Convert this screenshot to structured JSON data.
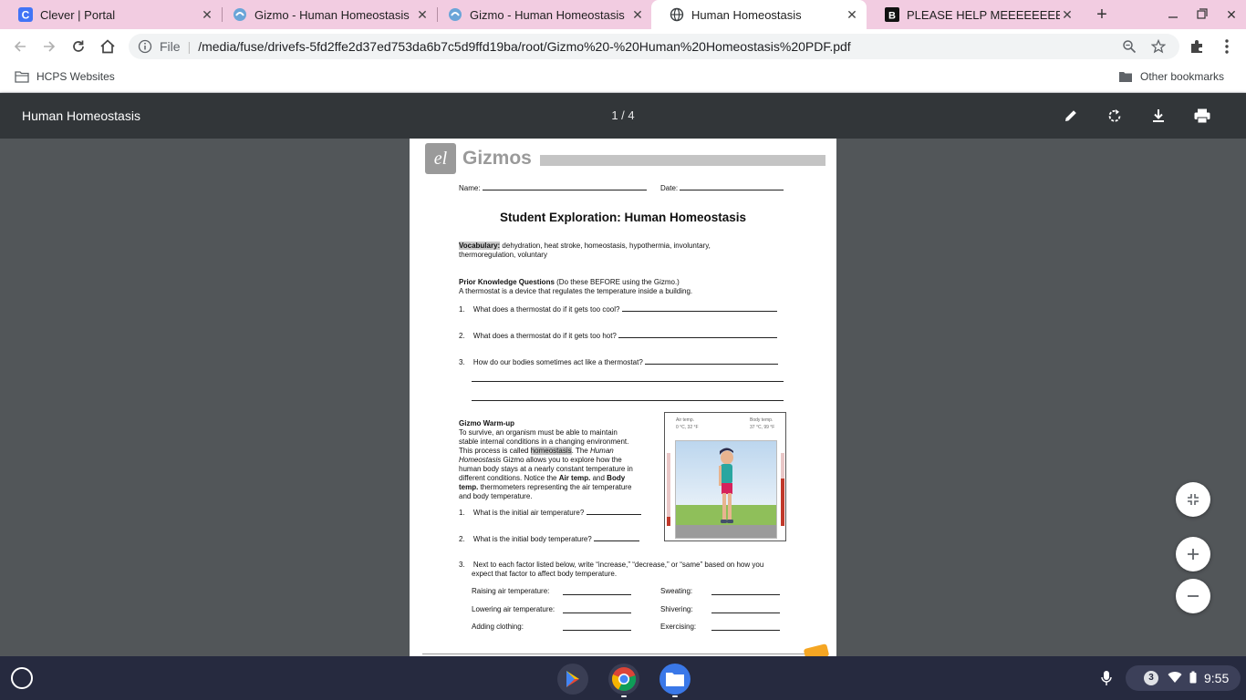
{
  "browser": {
    "tabs": [
      {
        "title": "Clever | Portal",
        "icon": "clever-icon",
        "active": false
      },
      {
        "title": "Gizmo - Human Homeostasis",
        "icon": "gizmo-icon",
        "active": false
      },
      {
        "title": "Gizmo - Human Homeostasis",
        "icon": "gizmo-icon",
        "active": false
      },
      {
        "title": "Human Homeostasis",
        "icon": "globe-icon",
        "active": true
      },
      {
        "title": "PLEASE HELP MEEEEEEEEEEEE",
        "icon": "brainly-icon",
        "active": false
      }
    ],
    "new_tab": "+",
    "address": {
      "scheme": "File",
      "url": "/media/fuse/drivefs-5fd2ffe2d37ed753da6b7c5d9ffd19ba/root/Gizmo%20-%20Human%20Homeostasis%20PDF.pdf"
    },
    "bookmarks": {
      "left": "HCPS Websites",
      "right": "Other bookmarks"
    }
  },
  "pdf": {
    "title": "Human Homeostasis",
    "page_indicator": "1 / 4",
    "document": {
      "brand": "Gizmos",
      "logo_letters": "el",
      "name_label": "Name:",
      "date_label": "Date:",
      "heading": "Student Exploration: Human Homeostasis",
      "vocab_label": "Vocabulary:",
      "vocab_line1": " dehydration, heat stroke, homeostasis, hypothermia, involuntary,",
      "vocab_line2": "thermoregulation, voluntary",
      "pk_title": "Prior Knowledge Questions",
      "pk_note": " (Do these BEFORE using the Gizmo.)",
      "pk_intro": "A thermostat is a device that regulates the temperature inside a building.",
      "pk_q1": "What does a thermostat do if it gets too cool?",
      "pk_q2": "What does a thermostat do if it gets too hot?",
      "pk_q3": "How do our bodies sometimes act like a thermostat?",
      "wu_title": "Gizmo Warm-up",
      "wu_l1": "To survive, an organism must be able to maintain",
      "wu_l2": "stable internal conditions in a changing environment.",
      "wu_l3a": "This process is called ",
      "wu_l3b": "homeostasis",
      "wu_l3c": ". The ",
      "wu_l3d": "Human",
      "wu_l4a": "Homeostasis",
      "wu_l4b": " Gizmo allows you to explore how the",
      "wu_l5": "human body stays at a nearly constant temperature in",
      "wu_l6a": "different conditions. Notice the ",
      "wu_l6b": "Air temp.",
      "wu_l6c": " and ",
      "wu_l6d": "Body",
      "wu_l7a": "temp.",
      "wu_l7b": " thermometers representing the air temperature",
      "wu_l8": "and body temperature.",
      "wu_q1": "What is the initial air temperature?",
      "wu_q2": "What is the initial body temperature?",
      "wu_q3_l1": "Next to each factor listed below, write “increase,” “decrease,” or “same” based on how you",
      "wu_q3_l2": "expect that factor to affect body temperature.",
      "factors_left": [
        "Raising air temperature:",
        "Lowering air temperature:",
        "Adding clothing:"
      ],
      "factors_right": [
        "Sweating:",
        "Shivering:",
        "Exercising:"
      ],
      "figure": {
        "air_label": "Air temp.",
        "air_value": "0 °C, 32 °F",
        "body_label": "Body temp.",
        "body_value": "37 °C, 99 °F"
      },
      "n1": "1.",
      "n2": "2.",
      "n3": "3."
    }
  },
  "shelf": {
    "apps": [
      "play-store-icon",
      "chrome-icon",
      "files-icon"
    ],
    "notification_count": "3",
    "time": "9:55"
  }
}
